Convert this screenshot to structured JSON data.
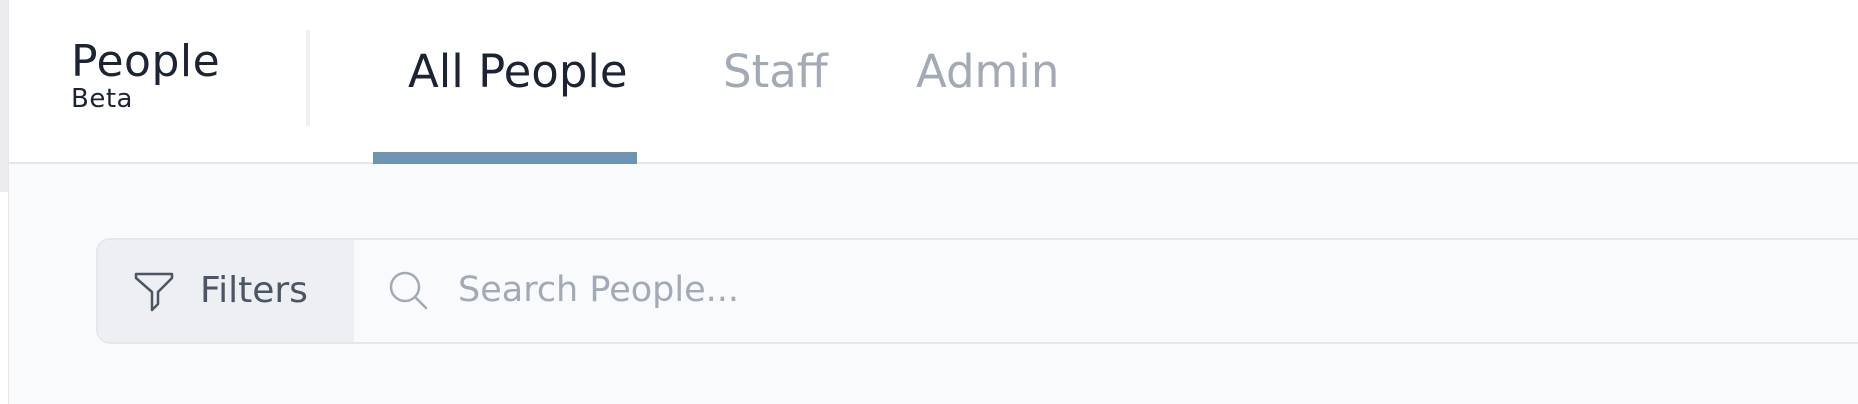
{
  "brand": {
    "title": "People",
    "subtitle": "Beta"
  },
  "tabs": [
    {
      "label": "All People",
      "active": true
    },
    {
      "label": "Staff",
      "active": false
    },
    {
      "label": "Admin",
      "active": false
    }
  ],
  "toolbar": {
    "filters_label": "Filters",
    "filters_icon": "filter-funnel-icon",
    "search_icon": "search-icon",
    "search_value": "",
    "search_placeholder": "Search People..."
  },
  "colors": {
    "text_primary": "#1c2433",
    "text_muted": "#a2aab6",
    "accent_underline": "#6f94b3",
    "filters_bg": "#edeff3",
    "content_bg": "#f9fafc"
  }
}
